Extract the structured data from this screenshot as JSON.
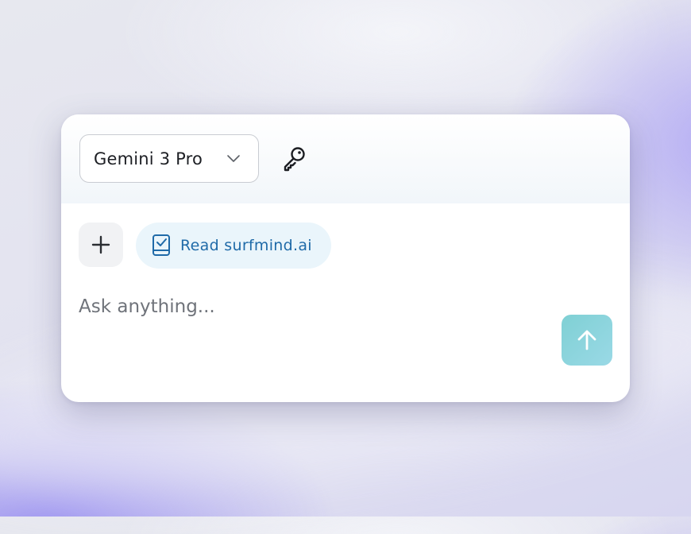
{
  "composer": {
    "model_selector": {
      "selected": "Gemini 3 Pro",
      "icon": "chevron-down-icon"
    },
    "key_button_icon": "key-icon",
    "add_button_icon": "plus-icon",
    "context_chip": {
      "label": "Read surfmind.ai",
      "icon": "book-check-icon"
    },
    "input": {
      "placeholder": "Ask anything...",
      "value": ""
    },
    "send_button_icon": "arrow-up-icon"
  },
  "colors": {
    "accent": "#1f6aa8",
    "send_button": "#8dd4dc",
    "chip_background": "#eaf5fb"
  }
}
